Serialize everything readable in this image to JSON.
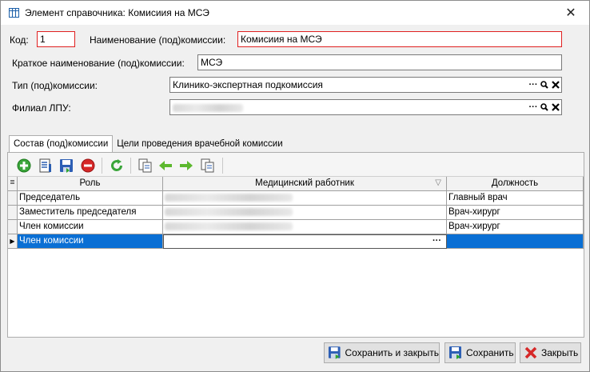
{
  "window": {
    "title": "Элемент справочника: Комисиия на МСЭ",
    "close_glyph": "✕"
  },
  "form": {
    "code_label": "Код:",
    "code_value": "1",
    "name_label": "Наименование (под)комиссии:",
    "name_value": "Комисиия на МСЭ",
    "short_label": "Краткое наименование (под)комиссии:",
    "short_value": "МСЭ",
    "type_label": "Тип (под)комиссии:",
    "type_value": "Клинико-экспертная подкомиссия",
    "branch_label": "Филиал ЛПУ:"
  },
  "tabs": [
    {
      "label": "Состав (под)комиссии",
      "active": true
    },
    {
      "label": "Цели проведения врачебной комиссии",
      "active": false
    }
  ],
  "grid": {
    "columns": {
      "role": "Роль",
      "worker": "Медицинский работник",
      "position": "Должность"
    },
    "rows": [
      {
        "role": "Председатель",
        "position": "Главный врач"
      },
      {
        "role": "Заместитель председателя",
        "position": "Врач-хирург"
      },
      {
        "role": "Член комиссии",
        "position": "Врач-хирург"
      },
      {
        "role": "Член комиссии",
        "position": ""
      }
    ]
  },
  "buttons": {
    "save_close": "Сохранить и закрыть",
    "save": "Сохранить",
    "close": "Закрыть"
  },
  "colors": {
    "required_border": "#e02020",
    "selection": "#0a6fd4"
  }
}
